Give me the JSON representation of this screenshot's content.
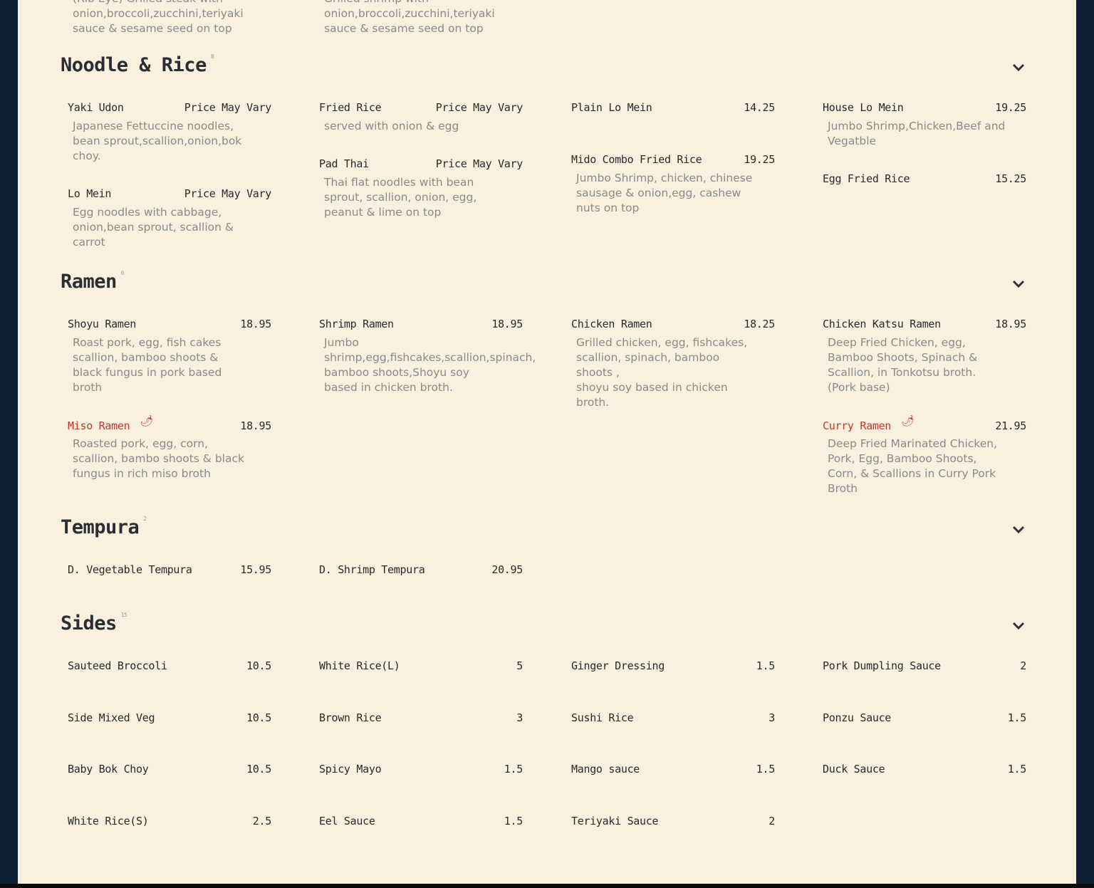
{
  "top_partial": [
    {
      "desc": "(Rib Eye) Grilled steak with\nonion,broccoli,zucchini,teriyaki\nsauce & sesame seed on top"
    },
    {
      "desc": "Grilled shrimp with\nonion,broccoli,zucchini,teriyaki\nsauce & sesame seed on top"
    }
  ],
  "sections": [
    {
      "title": "Noodle & Rice",
      "count": "8",
      "items": [
        {
          "name": "Yaki Udon",
          "price": "Price May Vary",
          "desc": "Japanese Fettuccine noodles,\nbean sprout,scallion,onion,bok\nchoy."
        },
        {
          "name": "Lo Mein",
          "price": "Price May Vary",
          "desc": "Egg noodles with cabbage,\nonion,bean sprout, scallion &\ncarrot"
        },
        {
          "name": "Fried Rice",
          "price": "Price May Vary",
          "desc": "served with onion & egg"
        },
        {
          "name": "Pad Thai",
          "price": "Price May Vary",
          "desc": "Thai flat noodles with bean\nsprout, scallion, onion, egg,\npeanut & lime on top"
        },
        {
          "name": "Plain Lo Mein",
          "price": "14.25",
          "desc": ""
        },
        {
          "name": "Mido Combo Fried Rice",
          "price": "19.25",
          "desc": "Jumbo Shrimp, chicken, chinese\nsausage & onion,egg, cashew\nnuts on top"
        },
        {
          "name": "House Lo Mein",
          "price": "19.25",
          "desc": "Jumbo Shrimp,Chicken,Beef and\nVegatble"
        },
        {
          "name": "Egg Fried Rice",
          "price": "15.25",
          "desc": ""
        }
      ]
    },
    {
      "title": "Ramen",
      "count": "6",
      "items": [
        {
          "name": "Shoyu Ramen",
          "price": "18.95",
          "desc": "Roast pork, egg, fish cakes\nscallion, bamboo shoots &\nblack fungus in pork based\nbroth"
        },
        {
          "name": "Miso Ramen",
          "price": "18.95",
          "spicy": true,
          "desc": "Roasted pork, egg, corn,\nscallion, bambo shoots & black\nfungus in rich miso broth"
        },
        {
          "name": "Shrimp Ramen",
          "price": "18.95",
          "desc": "Jumbo\nshrimp,egg,fishcakes,scallion,spinach,\nbamboo shoots,Shoyu soy\nbased in chicken broth."
        },
        {
          "name": "Chicken Ramen",
          "price": "18.25",
          "desc": "Grilled chicken,  egg,  fishcakes,\nscallion,  spinach, bamboo\nshoots ,\nshoyu soy based in chicken\nbroth."
        },
        {
          "name": "Chicken Katsu Ramen",
          "price": "18.95",
          "desc": "Deep Fried Chicken, egg,\nBamboo Shoots, Spinach &\nScallion, in Tonkotsu broth.\n(Pork base)"
        },
        {
          "name": "Curry Ramen",
          "price": "21.95",
          "spicy": true,
          "desc": "Deep Fried Marinated Chicken,\nPork, Egg, Bamboo Shoots,\nCorn, & Scallions in Curry Pork\nBroth"
        }
      ]
    },
    {
      "title": "Tempura",
      "count": "2",
      "items": [
        {
          "name": "D. Vegetable Tempura",
          "price": "15.95",
          "desc": ""
        },
        {
          "name": "D. Shrimp Tempura",
          "price": "20.95",
          "desc": ""
        }
      ]
    },
    {
      "title": "Sides",
      "count": "15",
      "items": [
        {
          "name": "Sauteed Broccoli",
          "price": "10.5"
        },
        {
          "name": "Side Mixed Veg",
          "price": "10.5"
        },
        {
          "name": "Baby Bok Choy",
          "price": "10.5"
        },
        {
          "name": "White Rice(S)",
          "price": "2.5"
        },
        {
          "name": "White Rice(L)",
          "price": "5"
        },
        {
          "name": "Brown Rice",
          "price": "3"
        },
        {
          "name": "Spicy Mayo",
          "price": "1.5"
        },
        {
          "name": "Eel Sauce",
          "price": "1.5"
        },
        {
          "name": "Ginger Dressing",
          "price": "1.5"
        },
        {
          "name": "Sushi Rice",
          "price": "3"
        },
        {
          "name": "Mango sauce",
          "price": "1.5"
        },
        {
          "name": "Teriyaki Sauce",
          "price": "2"
        },
        {
          "name": "Pork Dumpling Sauce",
          "price": "2"
        },
        {
          "name": "Ponzu Sauce",
          "price": "1.5"
        },
        {
          "name": "Duck Sauce",
          "price": "1.5"
        }
      ]
    }
  ],
  "icons": {
    "chevron": "chevron-down-icon",
    "spicy": "chili-pepper-icon"
  },
  "colors": {
    "background": "#f9f0df",
    "frame": "#0d1f33",
    "spicy_name": "#c0392b",
    "desc": "#8a8a8a"
  }
}
